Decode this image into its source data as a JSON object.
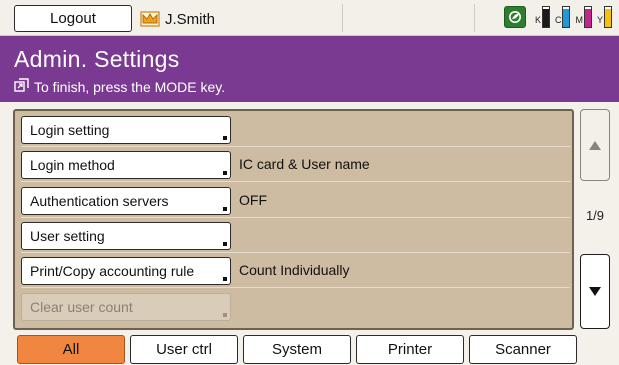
{
  "topbar": {
    "logout_label": "Logout",
    "user_name": "J.Smith",
    "toner": [
      {
        "label": "K",
        "color": "#1a1a1a",
        "level": 0.9
      },
      {
        "label": "C",
        "color": "#1f9ad6",
        "level": 0.9
      },
      {
        "label": "M",
        "color": "#c2278c",
        "level": 0.9
      },
      {
        "label": "Y",
        "color": "#f4c20d",
        "level": 0.9
      }
    ]
  },
  "header": {
    "title": "Admin. Settings",
    "subtitle": "To finish, press the MODE key.",
    "bg_color": "#7a3a91"
  },
  "settings": [
    {
      "label": "Login setting",
      "value": "",
      "enabled": true
    },
    {
      "label": "Login method",
      "value": "IC card & User name",
      "enabled": true
    },
    {
      "label": "Authentication servers",
      "value": "OFF",
      "enabled": true
    },
    {
      "label": "User setting",
      "value": "",
      "enabled": true
    },
    {
      "label": "Print/Copy accounting rule",
      "value": "Count Individually",
      "enabled": true
    },
    {
      "label": "Clear user count",
      "value": "",
      "enabled": false
    }
  ],
  "pager": {
    "indicator": "1/9",
    "up_icon": "triangle-up-icon",
    "down_icon": "triangle-down-icon"
  },
  "tabs": [
    {
      "label": "All",
      "active": true
    },
    {
      "label": "User ctrl",
      "active": false
    },
    {
      "label": "System",
      "active": false
    },
    {
      "label": "Printer",
      "active": false
    },
    {
      "label": "Scanner",
      "active": false
    }
  ]
}
